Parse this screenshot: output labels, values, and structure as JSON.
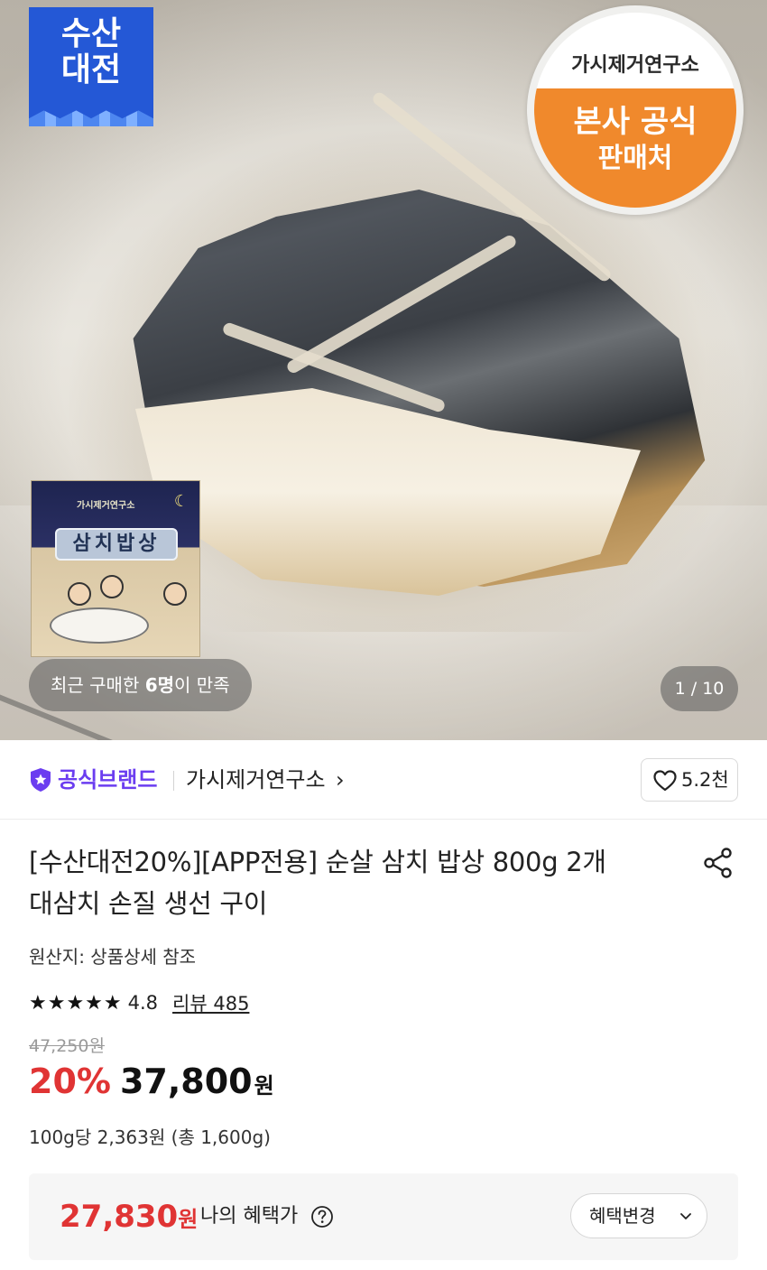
{
  "hero": {
    "badge_left": {
      "line1": "수산",
      "line2": "대전"
    },
    "badge_right": {
      "brand": "가시제거연구소",
      "line1": "본사 공식",
      "line2": "판매처"
    },
    "package": {
      "brand": "가시제거연구소",
      "title": "삼치밥상"
    },
    "satisfaction": {
      "prefix": "최근 구매한 ",
      "highlight": "6명",
      "suffix": "이 만족"
    },
    "pager": "1 / 10"
  },
  "brand_row": {
    "official_label": "공식브랜드",
    "store_name": "가시제거연구소",
    "store_chevron": "›",
    "likes": "5.2천"
  },
  "product": {
    "title_line1": "[수산대전20%][APP전용] 순살 삼치 밥상 800g 2개",
    "title_line2": "대삼치 손질 생선 구이",
    "origin": "원산지: 상품상세 참조",
    "stars": "★★★★★",
    "rating": "4.8",
    "review": "리뷰 485",
    "original_price": "47,250원",
    "discount": "20%",
    "price": "37,800",
    "won": "원",
    "unit_price": "100g당 2,363원 (총 1,600g)"
  },
  "benefit": {
    "price": "27,830",
    "won": "원",
    "label": "나의 혜택가",
    "button_label": "혜택변경"
  },
  "colors": {
    "accent_red": "#e03434",
    "brand_purple": "#6b3df0",
    "badge_blue": "#2458d6",
    "badge_orange": "#f0892c"
  },
  "icons": [
    "shield-star-icon",
    "heart-icon",
    "share-icon",
    "question-icon",
    "chevron-down-icon"
  ]
}
